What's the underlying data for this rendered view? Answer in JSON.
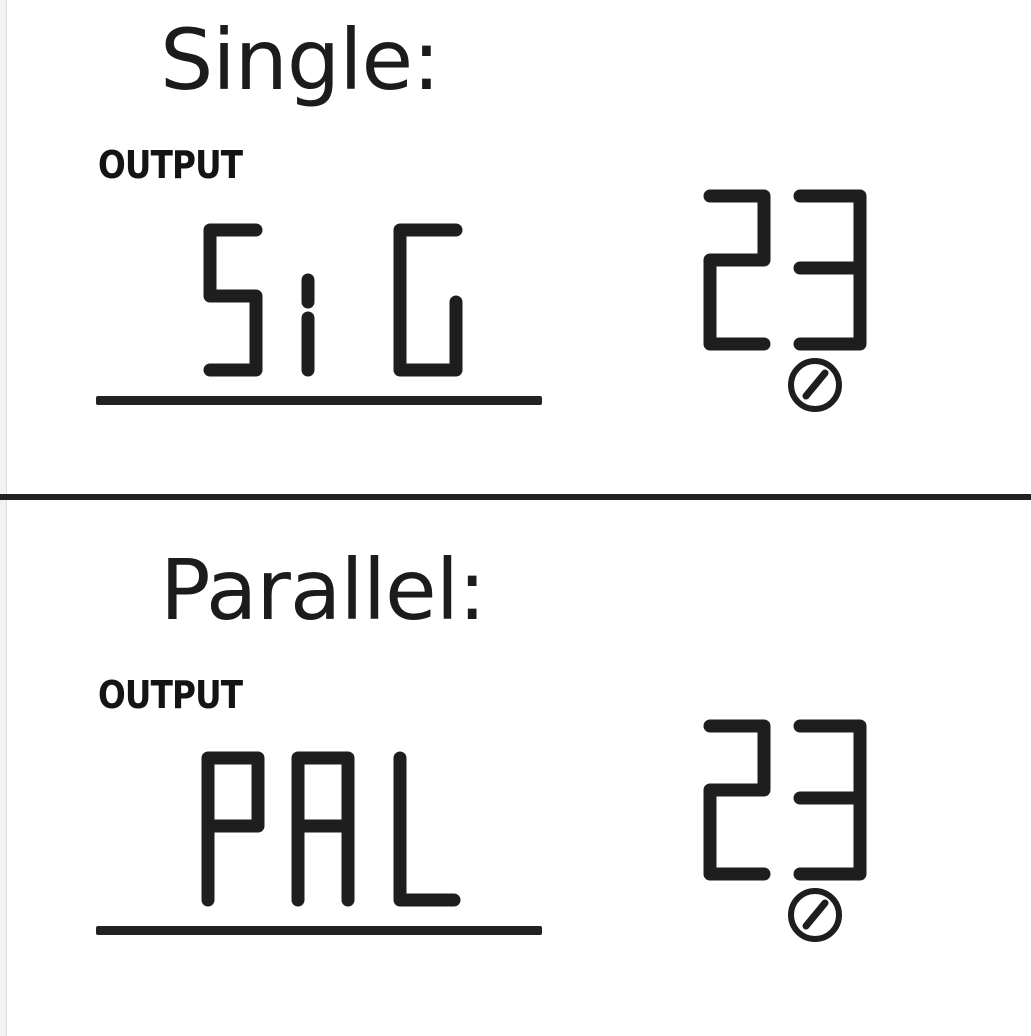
{
  "modes": [
    {
      "title": "Single:",
      "output_label": "OUTPUT",
      "display_code": "SIG",
      "program_number": "23",
      "setting_icon": "setting-knob-icon"
    },
    {
      "title": "Parallel:",
      "output_label": "OUTPUT",
      "display_code": "PAL",
      "program_number": "23",
      "setting_icon": "setting-knob-icon"
    }
  ],
  "colors": {
    "ink": "#1e1e1e",
    "background": "#ffffff"
  }
}
